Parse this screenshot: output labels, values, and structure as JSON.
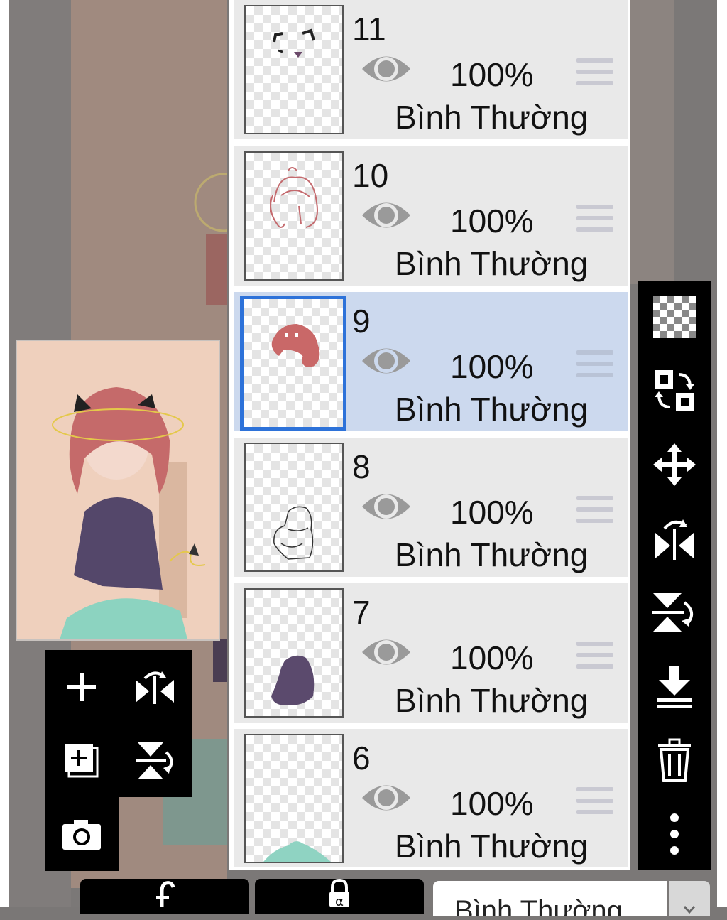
{
  "layers": [
    {
      "number": "11",
      "opacity": "100%",
      "blend": "Bình Thường",
      "selected": false
    },
    {
      "number": "10",
      "opacity": "100%",
      "blend": "Bình Thường",
      "selected": false
    },
    {
      "number": "9",
      "opacity": "100%",
      "blend": "Bình Thường",
      "selected": true
    },
    {
      "number": "8",
      "opacity": "100%",
      "blend": "Bình Thường",
      "selected": false
    },
    {
      "number": "7",
      "opacity": "100%",
      "blend": "Bình Thường",
      "selected": false
    },
    {
      "number": "6",
      "opacity": "100%",
      "blend": "Bình Thường",
      "selected": false
    }
  ],
  "blend_mode_select": {
    "value": "Bình Thường"
  },
  "icons": {
    "left_tools": [
      "add-layer-icon",
      "flip-horizontal-icon",
      "duplicate-layer-icon",
      "flip-vertical-icon",
      "camera-icon"
    ],
    "right_tools": [
      "transparency-icon",
      "swap-layer-icon",
      "move-icon",
      "flip-horizontal-icon",
      "flip-vertical-icon",
      "merge-down-icon",
      "trash-icon",
      "more-icon"
    ],
    "bottom": [
      "clipping-icon",
      "alpha-lock-icon"
    ]
  },
  "colors": {
    "selected_row": "#ccd9ee",
    "selected_border": "#2d72d9",
    "row_background": "#e9e9e9",
    "toolbar": "#000000"
  }
}
